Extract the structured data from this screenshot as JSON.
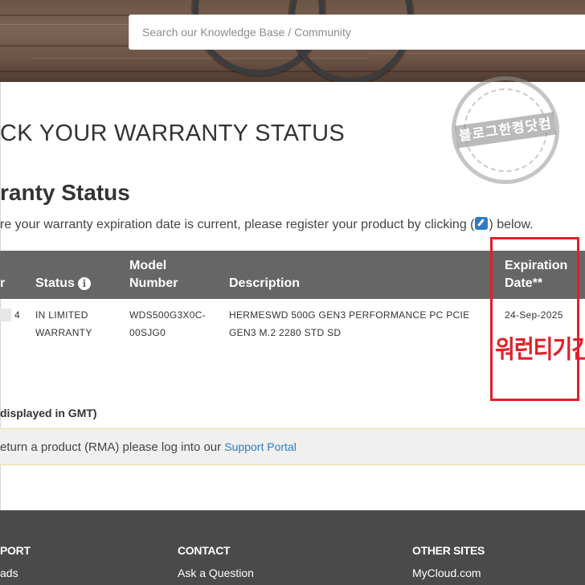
{
  "search": {
    "placeholder": "Search our Knowledge Base / Community"
  },
  "page": {
    "title": "CK YOUR WARRANTY STATUS",
    "section_title": "ranty Status",
    "intro_before_icon": "re your warranty expiration date is current, please register your product by clicking (",
    "intro_after_icon": ") below."
  },
  "table": {
    "headers": {
      "serial_fragment": "r",
      "status": "Status",
      "model_line1": "Model",
      "model_line2": "Number",
      "description": "Description",
      "expiration_line1": "Expiration",
      "expiration_line2": "Date**"
    },
    "row": {
      "serial_suffix": "4",
      "status_line1": "IN LIMITED",
      "status_line2": "WARRANTY",
      "model_line1": "WDS500G3X0C-",
      "model_line2": "00SJG0",
      "description_line1": "HERMESWD 500G GEN3 PERFORMANCE PC PCIE",
      "description_line2": "GEN3 M.2 2280 STD SD",
      "expiration": "24-Sep-2025"
    }
  },
  "gmt_note": "displayed in GMT)",
  "rma": {
    "text": "eturn a product (RMA) please log into our ",
    "link": "Support Portal"
  },
  "footer": {
    "col1_heading": "PORT",
    "col1_link": "ads",
    "col2_heading": "CONTACT",
    "col2_link": "Ask a Question",
    "col3_heading": "OTHER SITES",
    "col3_link": "MyCloud.com"
  },
  "overlay": {
    "stamp_text": "블로그한켱닷컴",
    "annotation": "워런티기간"
  },
  "colors": {
    "table_header": "#666666",
    "link": "#2e7bc4",
    "annotation": "#e0202a",
    "footer": "#4a4a4a"
  },
  "icons": [
    "info-icon",
    "edit-icon"
  ]
}
